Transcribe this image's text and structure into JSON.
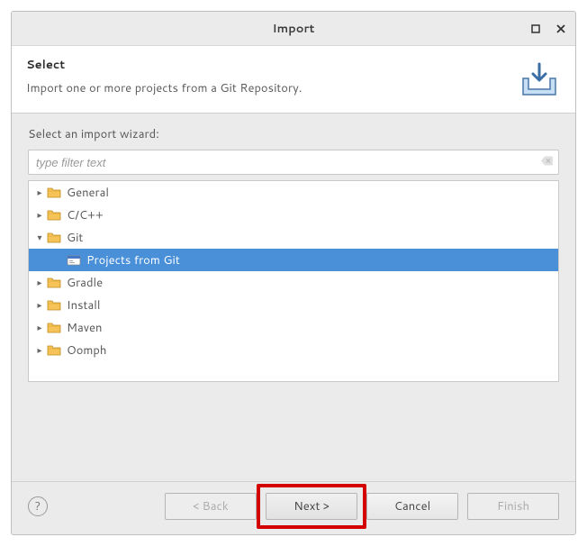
{
  "window": {
    "title": "Import"
  },
  "banner": {
    "title": "Select",
    "description": "Import one or more projects from a Git Repository."
  },
  "filter": {
    "label": "Select an import wizard:",
    "placeholder": "type filter text"
  },
  "tree": [
    {
      "label": "General",
      "expanded": false,
      "depth": 0
    },
    {
      "label": "C/C++",
      "expanded": false,
      "depth": 0
    },
    {
      "label": "Git",
      "expanded": true,
      "depth": 0
    },
    {
      "label": "Projects from Git",
      "expanded": null,
      "depth": 1,
      "selected": true,
      "leaf": true
    },
    {
      "label": "Gradle",
      "expanded": false,
      "depth": 0
    },
    {
      "label": "Install",
      "expanded": false,
      "depth": 0
    },
    {
      "label": "Maven",
      "expanded": false,
      "depth": 0
    },
    {
      "label": "Oomph",
      "expanded": false,
      "depth": 0
    }
  ],
  "buttons": {
    "help": "?",
    "back": "< Back",
    "next": "Next >",
    "cancel": "Cancel",
    "finish": "Finish"
  }
}
